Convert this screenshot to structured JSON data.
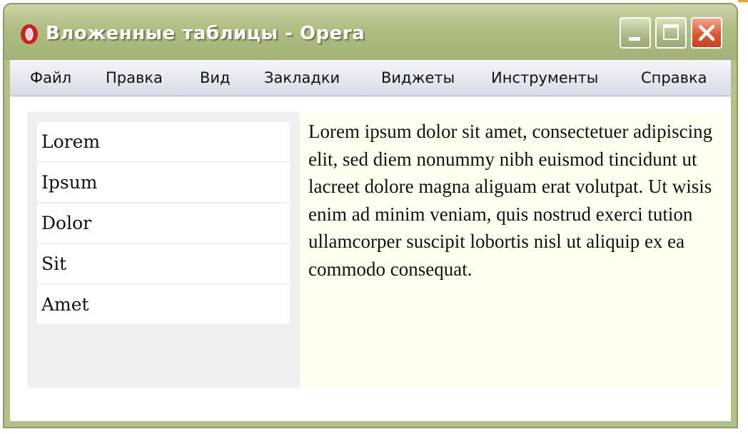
{
  "window": {
    "title": "Вложенные таблицы - Opera",
    "app_icon": "opera-logo-icon"
  },
  "controls": {
    "minimize_icon": "minimize-icon",
    "maximize_icon": "maximize-icon",
    "close_icon": "close-icon"
  },
  "menu": {
    "items": [
      {
        "label": "Файл"
      },
      {
        "label": "Правка"
      },
      {
        "label": "Вид"
      },
      {
        "label": "Закладки"
      },
      {
        "label": "Виджеты"
      },
      {
        "label": "Инструменты"
      },
      {
        "label": "Справка"
      }
    ]
  },
  "nested_table": {
    "rows": [
      "Lorem",
      "Ipsum",
      "Dolor",
      "Sit",
      "Amet"
    ]
  },
  "main_text": "Lorem ipsum dolor sit amet, consectetuer adipiscing elit, sed diem nonummy nibh euismod tincidunt ut lacreet dolore magna aliguam erat volutpat. Ut wisis enim ad minim veniam, quis nostrud exerci tution ullamcorper suscipit lobortis nisl ut aliquip ex ea commodo consequat.",
  "colors": {
    "titlebar": "#b3c08a",
    "close_button": "#e0552f",
    "left_cell_bg": "#efefef",
    "right_cell_bg": "#fffff0",
    "menubar": "#e6eaf0"
  }
}
